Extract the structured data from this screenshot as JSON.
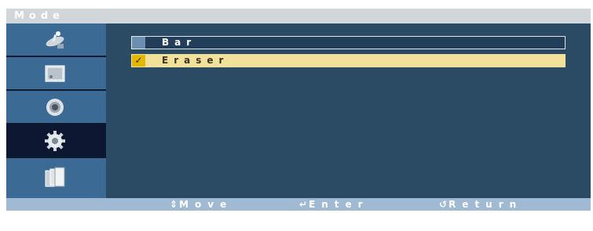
{
  "menu": {
    "title": "Mode"
  },
  "sidebar": {
    "items": [
      {
        "icon": "satellite-dish-icon",
        "active": false
      },
      {
        "icon": "picture-frame-icon",
        "active": false
      },
      {
        "icon": "speaker-icon",
        "active": false
      },
      {
        "icon": "gear-icon",
        "active": true
      },
      {
        "icon": "multi-screen-icon",
        "active": false
      }
    ]
  },
  "options": [
    {
      "label": "Bar",
      "selected": false
    },
    {
      "label": "Eraser",
      "selected": true,
      "mark": "✓"
    }
  ],
  "footer": {
    "move_glyph": "⇕",
    "move_label": "Move",
    "enter_glyph": "↵",
    "enter_label": "Enter",
    "return_glyph": "↺",
    "return_label": "Return"
  },
  "colors": {
    "panel": "#2b4a63",
    "sidebar": "#3b6b95",
    "active_item": "#0d1732",
    "selected_option": "#f2e19a",
    "footer": "#9fbad2"
  }
}
